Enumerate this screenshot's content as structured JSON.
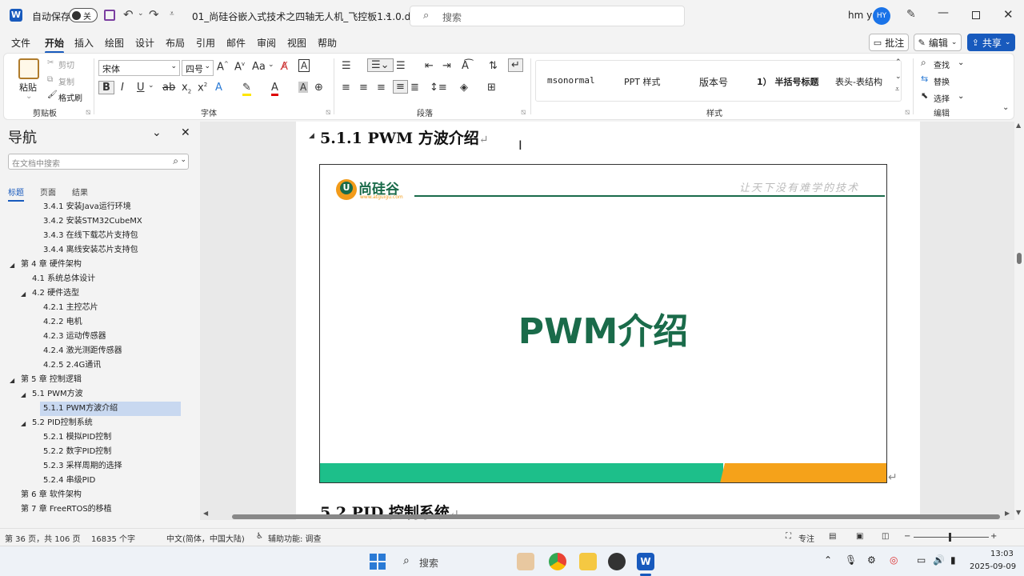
{
  "titlebar": {
    "autosave_label": "自动保存",
    "autosave_state": "关",
    "doc_title": "01_尚硅谷嵌入式技术之四轴无人机_飞控板1.1.0.d...",
    "search_placeholder": "搜索",
    "user_name": "hm y",
    "avatar_initials": "HY"
  },
  "menu": {
    "items": [
      "文件",
      "开始",
      "插入",
      "绘图",
      "设计",
      "布局",
      "引用",
      "邮件",
      "审阅",
      "视图",
      "帮助"
    ],
    "comment_label": "批注",
    "edit_label": "编辑",
    "share_label": "共享"
  },
  "ribbon": {
    "clipboard": {
      "paste": "粘贴",
      "cut": "剪切",
      "copy": "复制",
      "format_painter": "格式刷",
      "label": "剪贴板"
    },
    "font": {
      "font_name": "宋体",
      "font_size": "四号",
      "label": "字体",
      "aa": "Aa"
    },
    "paragraph": {
      "label": "段落"
    },
    "styles": {
      "items": [
        "msonormal",
        "PPT 样式",
        "版本号",
        "1） 半括号标题",
        "表头-表结构"
      ],
      "label": "样式"
    },
    "editing": {
      "find": "查找",
      "replace": "替换",
      "select": "选择",
      "label": "编辑"
    }
  },
  "nav": {
    "title": "导航",
    "search_placeholder": "在文档中搜索",
    "tabs": [
      "标题",
      "页面",
      "结果"
    ],
    "items": [
      {
        "label": "3.4.1 安装Java运行环境",
        "level": 3
      },
      {
        "label": "3.4.2 安装STM32CubeMX",
        "level": 3
      },
      {
        "label": "3.4.3 在线下载芯片支持包",
        "level": 3
      },
      {
        "label": "3.4.4 离线安装芯片支持包",
        "level": 3
      },
      {
        "label": "第 4 章 硬件架构",
        "level": 1
      },
      {
        "label": "4.1 系统总体设计",
        "level": 2
      },
      {
        "label": "4.2 硬件选型",
        "level": 2
      },
      {
        "label": "4.2.1 主控芯片",
        "level": 3
      },
      {
        "label": "4.2.2 电机",
        "level": 3
      },
      {
        "label": "4.2.3 运动传感器",
        "level": 3
      },
      {
        "label": "4.2.4 激光测距传感器",
        "level": 3
      },
      {
        "label": "4.2.5 2.4G通讯",
        "level": 3
      },
      {
        "label": "第 5 章 控制逻辑",
        "level": 1
      },
      {
        "label": "5.1 PWM方波",
        "level": 2
      },
      {
        "label": "5.1.1 PWM方波介绍",
        "level": 3
      },
      {
        "label": "5.2 PID控制系统",
        "level": 2
      },
      {
        "label": "5.2.1 模拟PID控制",
        "level": 3
      },
      {
        "label": "5.2.2 数字PID控制",
        "level": 3
      },
      {
        "label": "5.2.3 采样周期的选择",
        "level": 3
      },
      {
        "label": "5.2.4 串级PID",
        "level": 3
      },
      {
        "label": "第 6 章 软件架构",
        "level": 1
      },
      {
        "label": "第 7 章 FreeRTOS的移植",
        "level": 1
      }
    ]
  },
  "document": {
    "heading1": "5.1.1 PWM 方波介绍",
    "heading2": "5.2 PID 控制系统",
    "slide": {
      "logo_text": "尚硅谷",
      "logo_url": "www.atguigu.com",
      "slogan": "让天下没有难学的技术",
      "title": "PWM介绍"
    }
  },
  "status": {
    "page": "第 36 页，共 106 页",
    "words": "16835 个字",
    "language": "中文(简体，中国大陆)",
    "accessibility": "辅助功能: 调查",
    "focus": "专注"
  },
  "taskbar": {
    "search": "搜索",
    "time": "13:03",
    "date": "2025-09-09"
  },
  "colors": {
    "accent": "#185abd",
    "slide_green": "#1a6b4a",
    "bar_green": "#1dbf8a",
    "bar_orange": "#f5a21a"
  }
}
